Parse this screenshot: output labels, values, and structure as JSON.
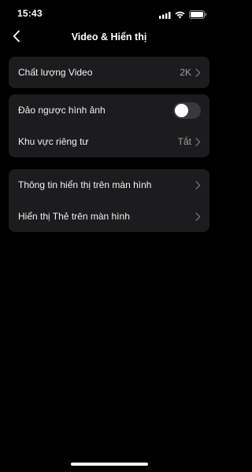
{
  "status_bar": {
    "time": "15:43",
    "icons": [
      "signal-icon",
      "wifi-icon",
      "battery-icon"
    ]
  },
  "nav": {
    "title": "Video & Hiển thị",
    "back_icon": "chevron-left-icon"
  },
  "groups": {
    "video": {
      "quality_label": "Chất lượng Video",
      "quality_value": "2K"
    },
    "image": {
      "flip_label": "Đảo ngược hình ảnh",
      "flip_enabled": false,
      "privacy_label": "Khu vực riêng tư",
      "privacy_value": "Tắt"
    },
    "display": {
      "osd_label": "Thông tin hiển thị trên màn hình",
      "card_label": "Hiển thị Thẻ trên màn hình"
    }
  },
  "colors": {
    "background": "#000000",
    "group_bg": "#1c1c1e",
    "toggle_off": "#39393d",
    "secondary_text": "#a0a0a0",
    "chevron": "#6e6e73"
  }
}
